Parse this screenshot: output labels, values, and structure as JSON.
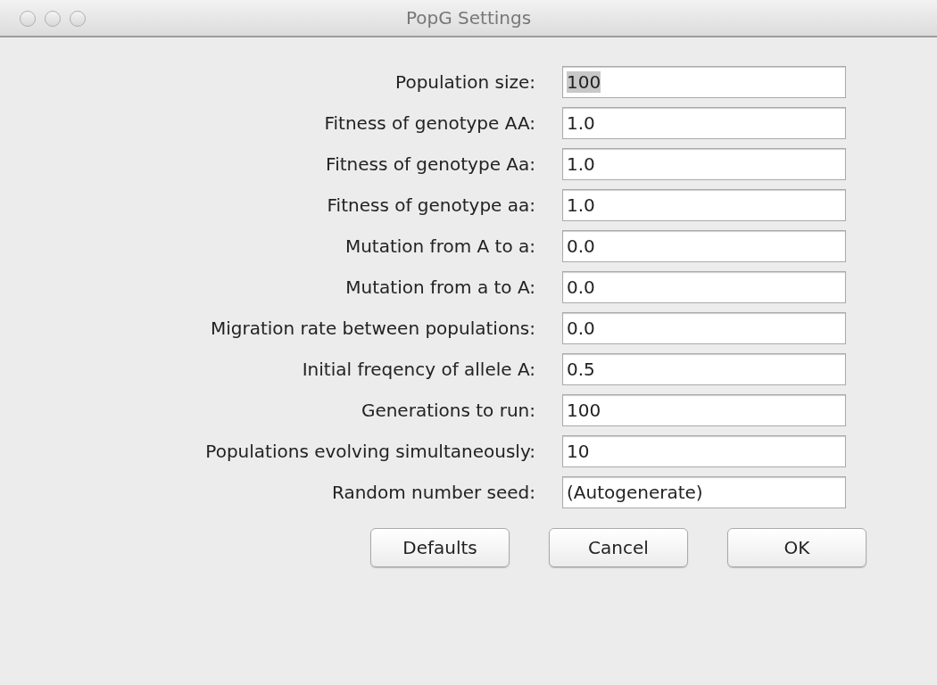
{
  "window": {
    "title": "PopG Settings"
  },
  "fields": [
    {
      "label": "Population size:",
      "value": "100",
      "text_selected": true
    },
    {
      "label": "Fitness of genotype AA:",
      "value": "1.0",
      "text_selected": false
    },
    {
      "label": "Fitness of genotype Aa:",
      "value": "1.0",
      "text_selected": false
    },
    {
      "label": "Fitness of genotype aa:",
      "value": "1.0",
      "text_selected": false
    },
    {
      "label": "Mutation from A to a:",
      "value": "0.0",
      "text_selected": false
    },
    {
      "label": "Mutation from a to A:",
      "value": "0.0",
      "text_selected": false
    },
    {
      "label": "Migration rate between populations:",
      "value": "0.0",
      "text_selected": false
    },
    {
      "label": "Initial freqency of allele A:",
      "value": "0.5",
      "text_selected": false
    },
    {
      "label": "Generations to run:",
      "value": "100",
      "text_selected": false
    },
    {
      "label": "Populations evolving simultaneously:",
      "value": "10",
      "text_selected": false
    },
    {
      "label": "Random number seed:",
      "value": "(Autogenerate)",
      "text_selected": false
    }
  ],
  "buttons": [
    "Defaults",
    "Cancel",
    "OK"
  ]
}
